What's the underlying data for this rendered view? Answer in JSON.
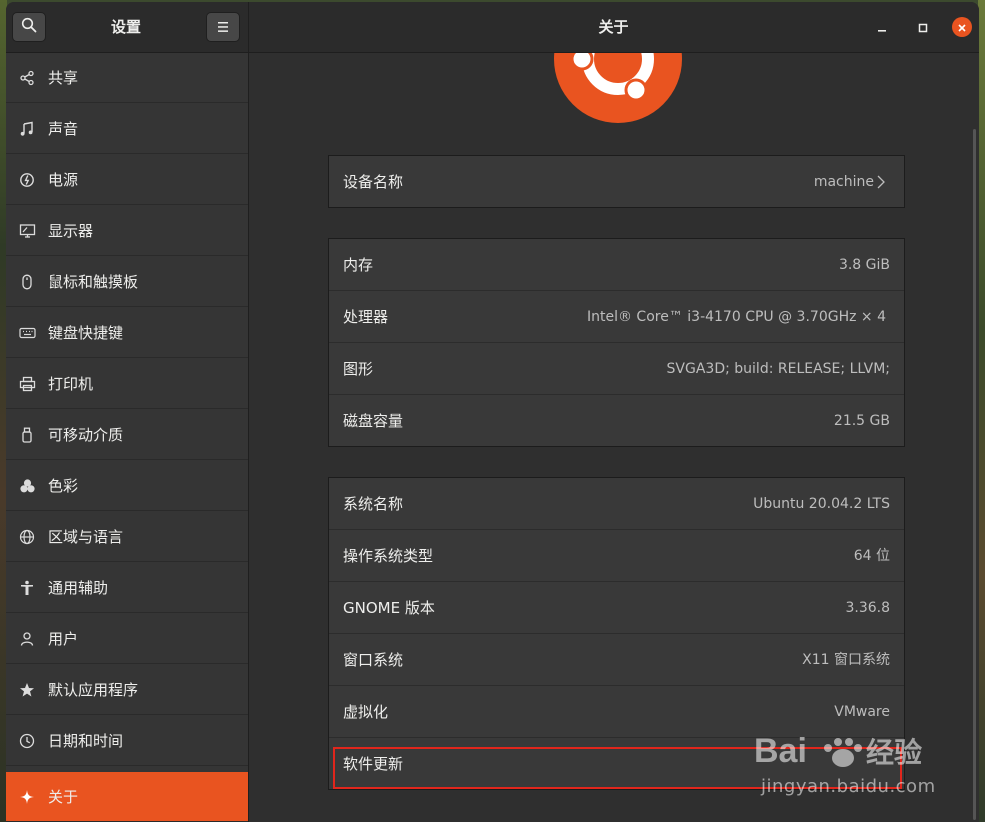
{
  "header": {
    "left_title": "设置",
    "main_title": "关于",
    "search_icon": "search-icon",
    "menu_icon": "hamburger-menu-icon"
  },
  "sidebar": {
    "items": [
      {
        "label": "共享",
        "icon": "share-icon"
      },
      {
        "label": "声音",
        "icon": "music-note-icon"
      },
      {
        "label": "电源",
        "icon": "power-icon"
      },
      {
        "label": "显示器",
        "icon": "display-icon"
      },
      {
        "label": "鼠标和触摸板",
        "icon": "mouse-icon"
      },
      {
        "label": "键盘快捷键",
        "icon": "keyboard-icon"
      },
      {
        "label": "打印机",
        "icon": "printer-icon"
      },
      {
        "label": "可移动介质",
        "icon": "removable-media-icon"
      },
      {
        "label": "色彩",
        "icon": "color-icon"
      },
      {
        "label": "区域与语言",
        "icon": "globe-icon"
      },
      {
        "label": "通用辅助",
        "icon": "accessibility-icon"
      },
      {
        "label": "用户",
        "icon": "user-icon"
      },
      {
        "label": "默认应用程序",
        "icon": "star-icon"
      },
      {
        "label": "日期和时间",
        "icon": "clock-icon"
      },
      {
        "label": "关于",
        "icon": "sparkle-icon"
      }
    ],
    "active_index": 14
  },
  "about": {
    "device": {
      "label": "设备名称",
      "value": "machine"
    },
    "hardware": [
      {
        "label": "内存",
        "value": "3.8 GiB"
      },
      {
        "label": "处理器",
        "value": "Intel® Core™ i3-4170 CPU @ 3.70GHz × 4"
      },
      {
        "label": "图形",
        "value": "SVGA3D; build: RELEASE; LLVM;"
      },
      {
        "label": "磁盘容量",
        "value": "21.5 GB"
      }
    ],
    "software": [
      {
        "label": "系统名称",
        "value": "Ubuntu 20.04.2 LTS"
      },
      {
        "label": "操作系统类型",
        "value": "64 位"
      },
      {
        "label": "GNOME 版本",
        "value": "3.36.8"
      },
      {
        "label": "窗口系统",
        "value": "X11 窗口系统"
      },
      {
        "label": "虚拟化",
        "value": "VMware"
      },
      {
        "label": "软件更新",
        "value": ""
      }
    ]
  },
  "watermark": {
    "brand": "Bai 经验",
    "url": "jingyan.baidu.com"
  },
  "colors": {
    "accent": "#e95420",
    "highlight_box": "#e1261c"
  }
}
